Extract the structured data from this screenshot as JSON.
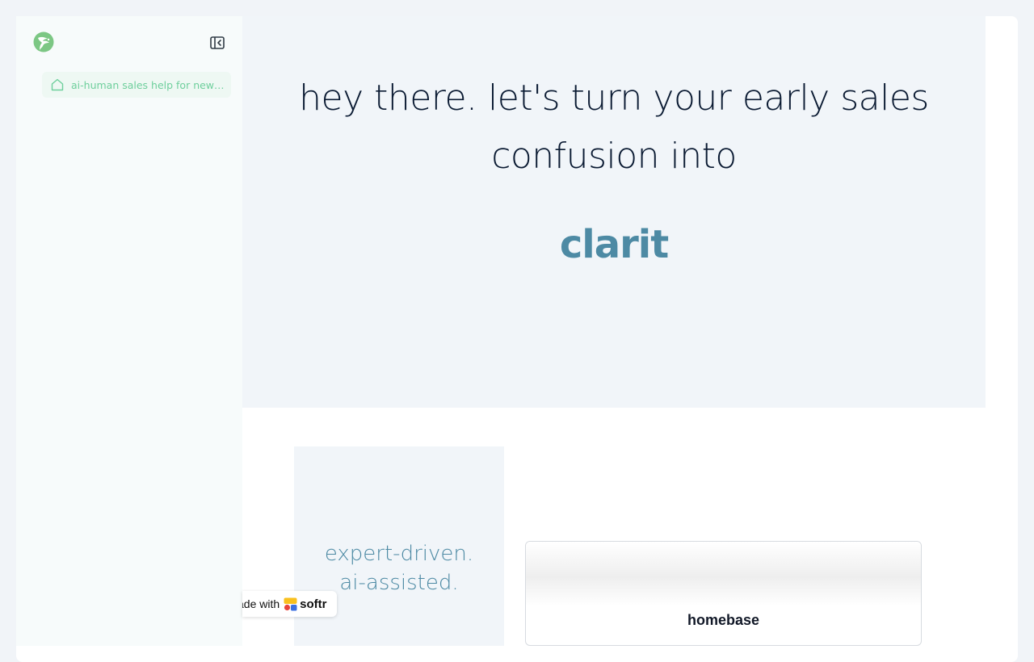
{
  "sidebar": {
    "logo_icon": "leaf-bird-logo",
    "collapse_icon": "sidebar-collapse-icon",
    "items": [
      {
        "label": "ai-human sales help for new ...",
        "icon": "home-icon"
      }
    ]
  },
  "hero": {
    "title_line1": "hey there. let's turn your early sales",
    "title_line2": "confusion into",
    "accent_word": "clarit"
  },
  "features": {
    "left_line1": "expert-driven.",
    "left_line2": "ai-assisted.",
    "right_title": "homebase"
  },
  "badge": {
    "prefix": "ade with",
    "brand": "softr"
  },
  "colors": {
    "accent": "#4d8aa4",
    "sidebar_active_text": "#6ecf9c",
    "logo_green": "#7cc784"
  }
}
